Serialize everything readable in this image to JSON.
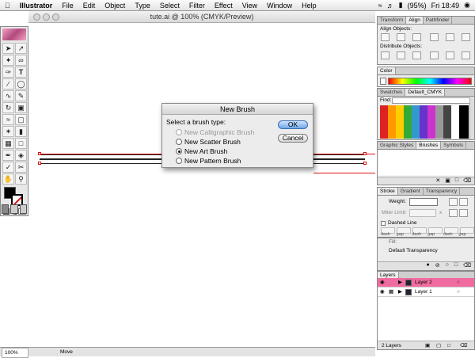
{
  "menubar": {
    "apple_icon": "apple-logo-icon",
    "app_name": "Illustrator",
    "items": [
      "File",
      "Edit",
      "Object",
      "Type",
      "Select",
      "Filter",
      "Effect",
      "View",
      "Window",
      "Help"
    ],
    "battery": "(95%)",
    "clock": "Fri 18:49"
  },
  "document": {
    "title": "tute.ai @ 100% (CMYK/Preview)"
  },
  "dialog": {
    "title": "New Brush",
    "prompt": "Select a brush type:",
    "options": [
      {
        "label": "New Calligraphic Brush",
        "enabled": false,
        "selected": false
      },
      {
        "label": "New Scatter Brush",
        "enabled": true,
        "selected": false
      },
      {
        "label": "New Art Brush",
        "enabled": true,
        "selected": true
      },
      {
        "label": "New Pattern Brush",
        "enabled": true,
        "selected": false
      }
    ],
    "ok_label": "OK",
    "cancel_label": "Cancel"
  },
  "panels": {
    "align": {
      "tabs": [
        "Transform",
        "Align",
        "Pathfinder"
      ],
      "active_tab": "Align",
      "align_label": "Align Objects:",
      "distribute_label": "Distribute Objects:"
    },
    "color": {
      "tabs": [
        "Color"
      ]
    },
    "swatches": {
      "tabs": [
        "Swatches",
        "Default_CMYK"
      ],
      "find_label": "Find:"
    },
    "brushes": {
      "tabs": [
        "Graphic Styles",
        "Brushes",
        "Symbols"
      ],
      "active_tab": "Brushes"
    },
    "stroke": {
      "tabs": [
        "Stroke",
        "Gradient",
        "Transparency"
      ],
      "active_tab": "Stroke",
      "weight_label": "Weight:",
      "miter_label": "Miter Limit:",
      "miter_unit": "x",
      "dashed_label": "Dashed Line",
      "dash_labels": [
        "dash",
        "gap",
        "dash",
        "gap",
        "dash",
        "gap"
      ]
    },
    "appearance": {
      "fill_label": "Fill:",
      "transparency_label": "Default Transparency"
    },
    "layers": {
      "tabs": [
        "Layers"
      ],
      "rows": [
        {
          "name": "Layer 2",
          "selected": true
        },
        {
          "name": "Layer 1",
          "selected": false
        }
      ],
      "count": "2 Layers"
    }
  },
  "status": {
    "zoom": "100%",
    "tool": "Move"
  },
  "colors": {
    "layer_highlight": "#f06ca0",
    "dialog_default_button": "#6fa6e8",
    "artwork_red": "#d11111"
  }
}
